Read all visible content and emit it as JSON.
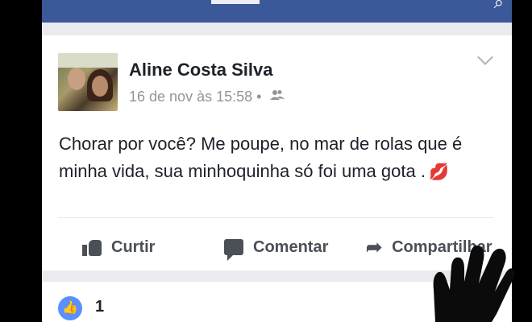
{
  "post": {
    "author": "Aline Costa Silva",
    "timestamp": "16 de nov às 15:58",
    "separator": "•",
    "audience_icon": "friends-icon",
    "text": "Chorar por você? Me poupe, no mar de rolas que é minha vida, sua minhoquinha só foi uma gota .",
    "emoji": "💋"
  },
  "actions": {
    "like_label": "Curtir",
    "comment_label": "Comentar",
    "share_label": "Compartilhar"
  },
  "reactions": {
    "count": "1"
  }
}
